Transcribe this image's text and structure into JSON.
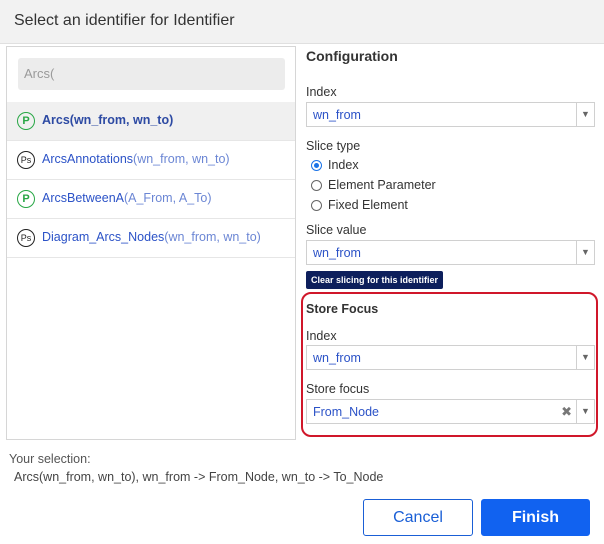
{
  "dialog": {
    "title": "Select an identifier for Identifier"
  },
  "search": {
    "value": "Arcs("
  },
  "list": [
    {
      "badge": "P",
      "name": "Arcs",
      "args": "(wn_from, wn_to)",
      "selected": true
    },
    {
      "badge": "Ps",
      "name": "ArcsAnnotations",
      "args": "(wn_from, wn_to)",
      "selected": false
    },
    {
      "badge": "P",
      "name": "ArcsBetweenA",
      "args": "(A_From, A_To)",
      "selected": false
    },
    {
      "badge": "Ps",
      "name": "Diagram_Arcs_Nodes",
      "args": "(wn_from, wn_to)",
      "selected": false
    }
  ],
  "config": {
    "title": "Configuration",
    "index_label": "Index",
    "index_value": "wn_from",
    "slice_type_label": "Slice type",
    "slice_options": [
      "Index",
      "Element Parameter",
      "Fixed Element"
    ],
    "slice_selected": "Index",
    "slice_value_label": "Slice value",
    "slice_value": "wn_from",
    "clear_button": "Clear slicing for this identifier"
  },
  "store_focus": {
    "title": "Store Focus",
    "index_label": "Index",
    "index_value": "wn_from",
    "focus_label": "Store focus",
    "focus_value": "From_Node",
    "clear_symbol": "✖"
  },
  "selection": {
    "label": "Your selection:",
    "value": "Arcs(wn_from, wn_to), wn_from -> From_Node, wn_to -> To_Node"
  },
  "buttons": {
    "cancel": "Cancel",
    "finish": "Finish"
  },
  "icons": {
    "dropdown": "caret-down-icon"
  },
  "colors": {
    "accent": "#1162f0",
    "highlight_border": "#d0172a",
    "link": "#2b52c7"
  }
}
